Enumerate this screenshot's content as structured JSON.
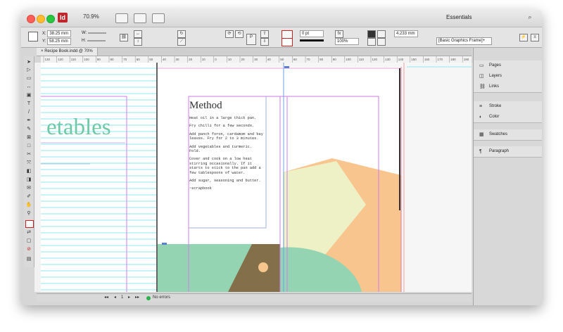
{
  "app": {
    "logo_text": "Id",
    "zoom": "70.9%",
    "workspace": "Essentials",
    "search_icon": "search-icon"
  },
  "control_panel": {
    "x_label": "X:",
    "x_value": "38.25 mm",
    "y_label": "Y:",
    "y_value": "58.25 mm",
    "w_label": "W:",
    "h_label": "H:",
    "stroke_weight": "0 pt",
    "opacity": "100%",
    "size_field": "4.233 mm",
    "object_style": "[Basic Graphics Frame]+"
  },
  "document": {
    "tab_label": "Recipe Book.indd @ 70%",
    "close_label": "×"
  },
  "page": {
    "heading_fragment": "etables",
    "method_title": "Method",
    "paragraphs": [
      "Heat oil in a large thick pan.",
      "Fry chilli for a few seconds.",
      "Add panch foron, cardamom and bay leaves. Fry for 2 to 3 minutes.",
      "Add vegetables and turmeric. Fold.",
      "Cover and cook on a low heat stirring occasionally. If it starts to stick to the pan add a few tablespoons of water.",
      "Add sugar, seasoning and butter.",
      "~scrapbook"
    ]
  },
  "ruler_ticks": [
    "130",
    "120",
    "110",
    "100",
    "90",
    "80",
    "70",
    "60",
    "50",
    "40",
    "30",
    "20",
    "10",
    "0",
    "10",
    "20",
    "30",
    "40",
    "50",
    "60",
    "70",
    "80",
    "90",
    "100",
    "110",
    "120",
    "130",
    "140",
    "150",
    "160",
    "170",
    "180",
    "190"
  ],
  "status": {
    "page_number": "1",
    "preflight": "No errors"
  },
  "panels": {
    "group1": [
      "Pages",
      "Layers",
      "Links"
    ],
    "group2": [
      "Stroke",
      "Color"
    ],
    "group3": [
      "Swatches"
    ],
    "group4": [
      "Paragraph"
    ]
  },
  "colors": {
    "mint": "#94d4b3",
    "peach": "#f9c58e",
    "pale_yellow": "#eef0c6",
    "brown": "#83704a",
    "title_green": "#6fc9a6",
    "guide_cyan": "#7fe6f0",
    "guide_magenta": "#d36bf0"
  }
}
